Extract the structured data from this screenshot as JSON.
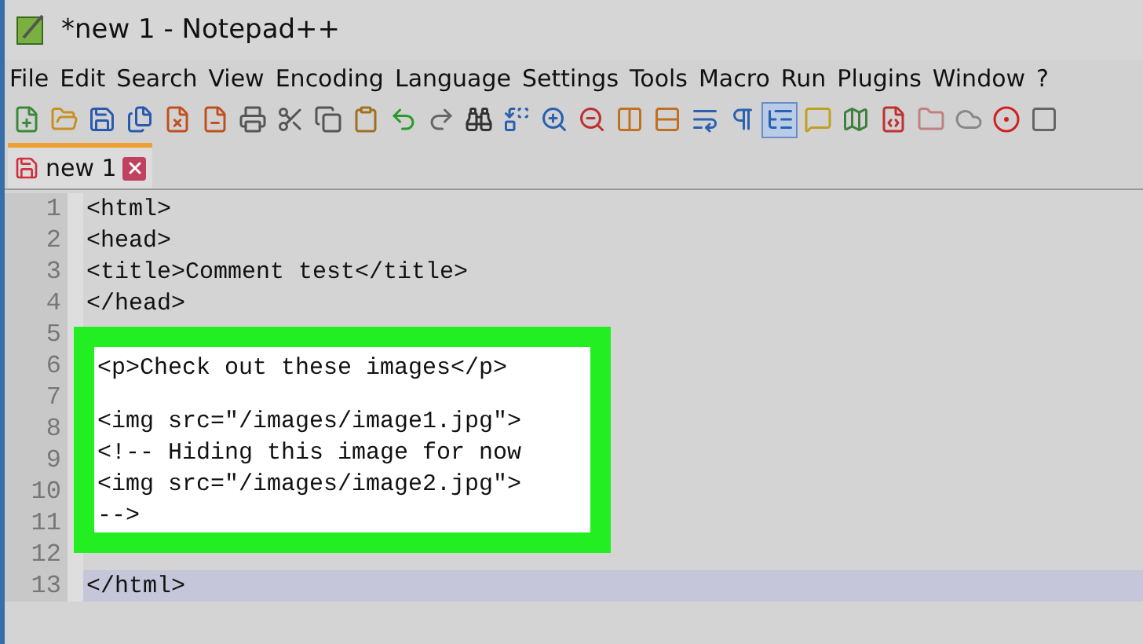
{
  "window": {
    "title": "*new 1 - Notepad++"
  },
  "menu": [
    "File",
    "Edit",
    "Search",
    "View",
    "Encoding",
    "Language",
    "Settings",
    "Tools",
    "Macro",
    "Run",
    "Plugins",
    "Window",
    "?"
  ],
  "toolbar": [
    {
      "on": false
    },
    {
      "on": false
    },
    {
      "on": false
    },
    {
      "on": false
    },
    {
      "on": false
    },
    {
      "on": false
    },
    {
      "on": false
    },
    {
      "on": false
    },
    {
      "on": false
    },
    {
      "on": false
    },
    {
      "on": false
    },
    {
      "on": false
    },
    {
      "on": false
    },
    {
      "on": false
    },
    {
      "on": false
    },
    {
      "on": false
    },
    {
      "on": false
    },
    {
      "on": false
    },
    {
      "on": false
    },
    {
      "on": false
    },
    {
      "on": true
    },
    {
      "on": false
    },
    {
      "on": false
    },
    {
      "on": false
    },
    {
      "on": false
    },
    {
      "on": false
    },
    {
      "on": false
    },
    {
      "on": false
    }
  ],
  "tabs": [
    {
      "label": "new 1",
      "selected": true
    }
  ],
  "editor": {
    "lines": [
      {
        "number": "1",
        "text": "<html>",
        "current": false
      },
      {
        "number": "2",
        "text": "<head>",
        "current": false
      },
      {
        "number": "3",
        "text": "<title>Comment test</title>",
        "current": false
      },
      {
        "number": "4",
        "text": "</head>",
        "current": false
      },
      {
        "number": "5",
        "current": false
      },
      {
        "number": "6",
        "current": false
      },
      {
        "number": "7",
        "current": false
      },
      {
        "number": "8",
        "current": false
      },
      {
        "number": "9",
        "current": false
      },
      {
        "number": "10",
        "current": false
      },
      {
        "number": "11",
        "current": false
      },
      {
        "number": "12",
        "current": false
      },
      {
        "number": "13",
        "text": "</html>",
        "current": true
      }
    ]
  },
  "highlight": {
    "lines": [
      {
        "kind": "code",
        "text": "<p>Check out these images</p>"
      },
      {
        "kind": "blank"
      },
      {
        "kind": "code",
        "text": "<img src=\"/images/image1.jpg\">"
      },
      {
        "kind": "code",
        "text": "<!-- Hiding this image for now"
      },
      {
        "kind": "code",
        "text": "<img src=\"/images/image2.jpg\">"
      },
      {
        "kind": "code",
        "text": "-->"
      }
    ]
  }
}
